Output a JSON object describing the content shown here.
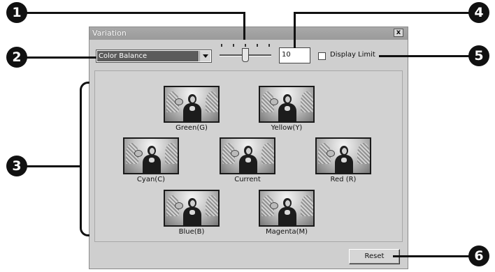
{
  "window": {
    "title": "Variation",
    "close_label": "x"
  },
  "controls": {
    "mode_select_value": "Color Balance",
    "step_value": "10",
    "display_limit_label": "Display Limit",
    "display_limit_checked": false
  },
  "thumbnails": [
    {
      "label": "Green(G)"
    },
    {
      "label": "Yellow(Y)"
    },
    {
      "label": "Cyan(C)"
    },
    {
      "label": "Current"
    },
    {
      "label": "Red (R)"
    },
    {
      "label": "Blue(B)"
    },
    {
      "label": "Magenta(M)"
    }
  ],
  "reset_label": "Reset",
  "callouts": [
    "1",
    "2",
    "3",
    "4",
    "5",
    "6"
  ]
}
